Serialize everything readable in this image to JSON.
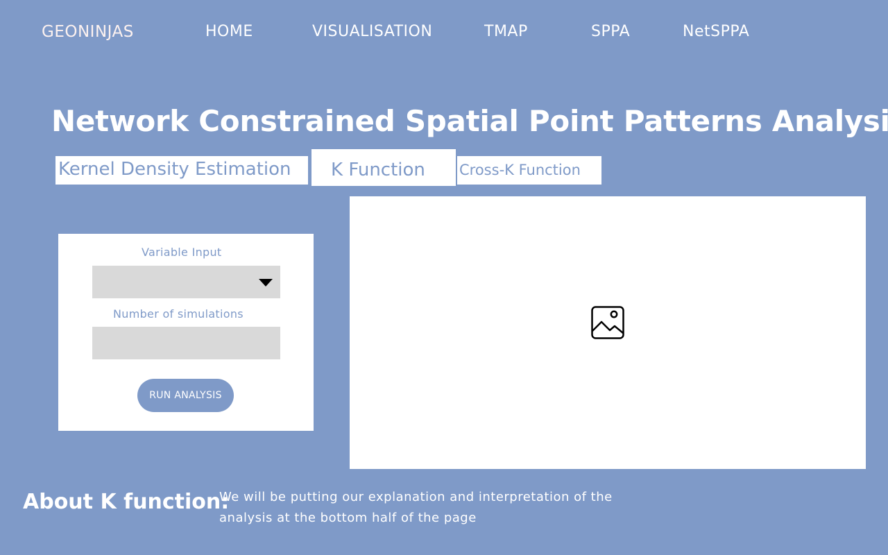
{
  "nav": {
    "brand": "GEONINJAS",
    "items": [
      "HOME",
      "VISUALISATION",
      "TMAP",
      "SPPA",
      "NetSPPA"
    ]
  },
  "page_title": "Network Constrained Spatial Point Patterns Analysis",
  "tabs": [
    {
      "label": "Kernel Density Estimation",
      "active": false
    },
    {
      "label": "K Function",
      "active": true
    },
    {
      "label": "Cross-K Function",
      "active": false
    }
  ],
  "controls": {
    "variable_label": "Variable Input",
    "variable_value": "",
    "simulations_label": "Number of simulations",
    "simulations_value": "",
    "run_button": "RUN ANALYSIS"
  },
  "output": {
    "placeholder_icon": "image-icon"
  },
  "about": {
    "heading": "About K function:",
    "text": "We will be putting our explanation and interpretation of the analysis at the bottom half of the page"
  },
  "colors": {
    "background": "#7f9ac8",
    "panel": "#ffffff",
    "input": "#d9d9d9",
    "accent": "#7f9ac8"
  }
}
